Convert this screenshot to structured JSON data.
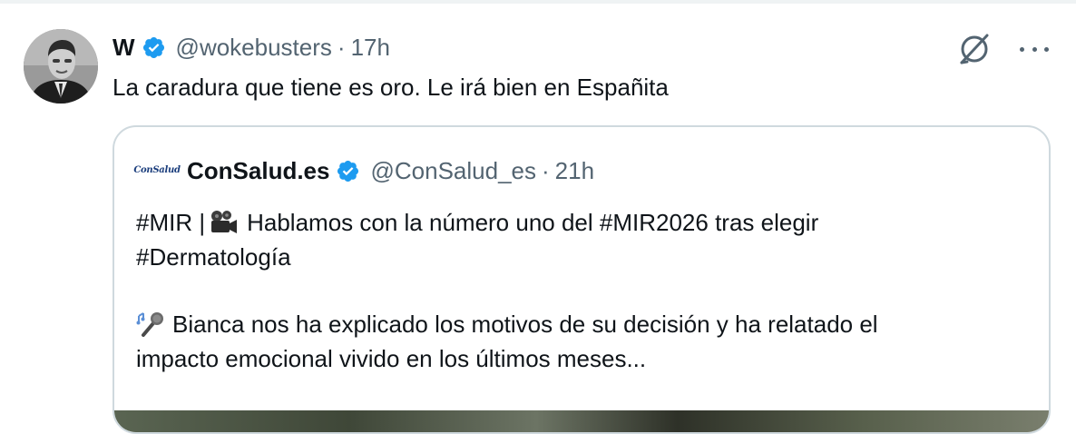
{
  "tweet": {
    "display_name": "W",
    "handle": "@wokebusters",
    "separator": "·",
    "time": "17h",
    "text": "La caradura que tiene es oro. Le irá bien en Españita",
    "avatar_icon": "person-photo-avatar",
    "actions": {
      "grok_icon": "grok-icon",
      "more_icon": "more-options-icon"
    }
  },
  "quote": {
    "avatar_text": "ConSalud",
    "display_name": "ConSalud.es",
    "handle": "@ConSalud_es",
    "separator": "·",
    "time": "21h",
    "line1_prefix": "#MIR |",
    "line1_emoji": "movie-camera-icon",
    "line1_text": "Hablamos con la número uno del #MIR2026 tras elegir",
    "line2_text": "#Dermatología",
    "line3_emoji": "microphone-icon",
    "line3_text": "Bianca nos ha explicado los motivos de su decisión y ha relatado el",
    "line4_text": "impacto emocional vivido en los últimos meses..."
  },
  "colors": {
    "text_primary": "#0f1419",
    "text_secondary": "#536471",
    "verified_blue": "#1d9bf0",
    "border": "#cfd9de"
  }
}
